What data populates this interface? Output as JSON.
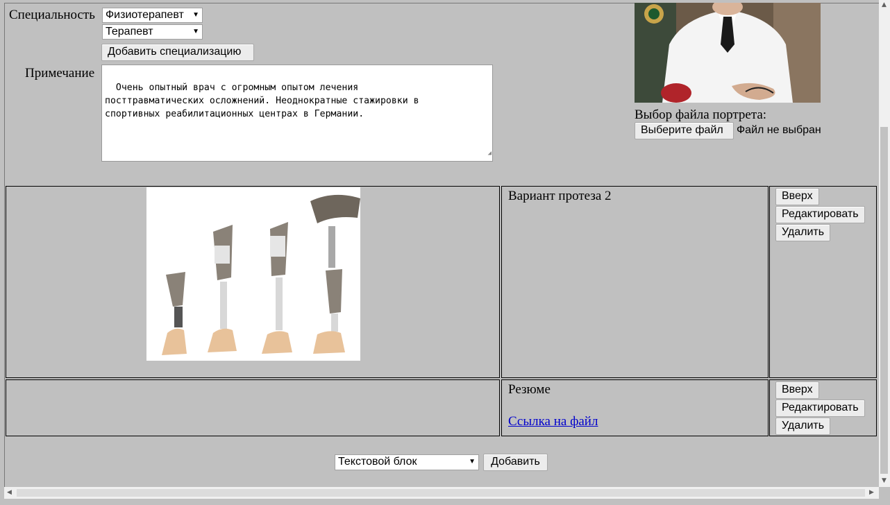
{
  "form": {
    "specialty_label": "Специальность",
    "specialty_1": "Физиотерапевт",
    "specialty_2": "Терапевт",
    "add_specialization_button": "Добавить специализацию",
    "note_label": "Примечание",
    "note_text": "Очень опытный врач с огромным опытом лечения\nпосттравматических осложнений. Неоднократные стажировки в\nспортивных реабилитационных центрах в Германии.",
    "portrait_label": "Выбор файла портрета:",
    "choose_file_button": "Выберите файл",
    "no_file_text": "Файл не выбран"
  },
  "blocks": [
    {
      "title": "Вариант протеза 2",
      "up": "Вверх",
      "edit": "Редактировать",
      "delete": "Удалить"
    },
    {
      "title": "Резюме",
      "link": "Ссылка на файл",
      "up": "Вверх",
      "edit": "Редактировать",
      "delete": "Удалить"
    }
  ],
  "footer": {
    "block_type": "Текстовой блок",
    "add_button": "Добавить"
  }
}
